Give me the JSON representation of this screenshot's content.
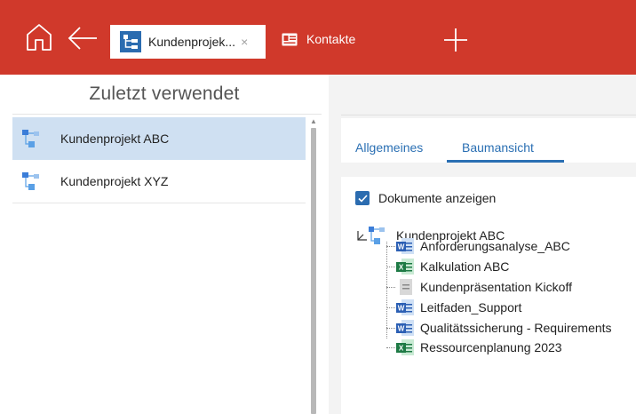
{
  "header": {
    "tabs": [
      {
        "label": "Kundenprojek...",
        "close": "×",
        "icon": "project-tree-icon"
      },
      {
        "label": "Kontakte",
        "icon": "contact-card-icon"
      }
    ]
  },
  "sidebar": {
    "title": "Zuletzt verwendet",
    "items": [
      {
        "label": "Kundenprojekt ABC",
        "selected": true
      },
      {
        "label": "Kundenprojekt XYZ",
        "selected": false
      }
    ]
  },
  "main": {
    "tabs": [
      {
        "label": "Allgemeines"
      },
      {
        "label": "Baumansicht",
        "active": true
      }
    ],
    "show_documents": {
      "label": "Dokumente anzeigen",
      "checked": true
    },
    "tree": {
      "root": "Kundenprojekt ABC",
      "children": [
        {
          "label": "Anforderungsanalyse_ABC",
          "type": "word"
        },
        {
          "label": "Kalkulation ABC",
          "type": "excel"
        },
        {
          "label": "Kundenpräsentation Kickoff",
          "type": "generic"
        },
        {
          "label": "Leitfaden_Support",
          "type": "word"
        },
        {
          "label": "Qualitätssicherung - Requirements",
          "type": "word"
        },
        {
          "label": "Ressourcenplanung 2023",
          "type": "excel"
        }
      ]
    }
  },
  "colors": {
    "accent": "#d0392b",
    "selection": "#cfe0f2",
    "link": "#2a6fb3",
    "word": "#2b5fb4",
    "excel": "#1e7a45"
  }
}
